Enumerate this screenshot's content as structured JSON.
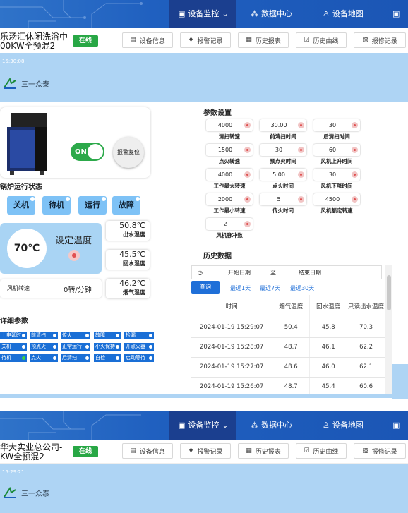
{
  "nav": {
    "items": [
      {
        "label": "设备监控",
        "icon": "monitor-icon"
      },
      {
        "label": "数据中心",
        "icon": "chart-icon"
      },
      {
        "label": "设备地图",
        "icon": "map-icon"
      },
      {
        "label": "",
        "icon": "monitor-icon"
      }
    ]
  },
  "device1": {
    "name_line1": "乐汤汇休闲洗浴中",
    "name_line2": "00KW全预混2",
    "status": "在线",
    "tabs": [
      "设备信息",
      "报警记录",
      "历史报表",
      "历史曲线",
      "报修记录"
    ],
    "timestamp": "15:30:08",
    "logo_text": "三一众泰",
    "on_label": "ON",
    "reset_label": "报警复位",
    "run_status_title": "锅炉运行状态",
    "status_buttons": [
      "关机",
      "待机",
      "运行",
      "故障"
    ],
    "set_temp_label": "设定温度",
    "set_temp_value": "70℃",
    "temps": [
      {
        "value": "50.8℃",
        "label": "出水温度"
      },
      {
        "value": "45.5℃",
        "label": "回水温度"
      },
      {
        "value": "46.2℃",
        "label": "烟气温度"
      }
    ],
    "fan_label": "风机转速",
    "fan_value": "0转/分钟",
    "detail_title": "详细参数",
    "detail_tags": [
      [
        "上电延时",
        "前清扫",
        "传火",
        "故障",
        "检漏"
      ],
      [
        "关机",
        "预点火",
        "正常运行",
        "小火保持",
        "开点火器"
      ],
      [
        "待机",
        "点火",
        "后清扫",
        "自检",
        "启动等待"
      ]
    ],
    "param_title": "参数设置",
    "params": [
      {
        "value": "4000",
        "label": "清扫转速"
      },
      {
        "value": "30.00",
        "label": "前清扫时间"
      },
      {
        "value": "30",
        "label": "后清扫时间"
      },
      {
        "value": "1500",
        "label": "点火转速"
      },
      {
        "value": "30",
        "label": "预点火时间"
      },
      {
        "value": "60",
        "label": "风机上升时间"
      },
      {
        "value": "4000",
        "label": "工作最大转速"
      },
      {
        "value": "5.00",
        "label": "点火时间"
      },
      {
        "value": "30",
        "label": "风机下降时间"
      },
      {
        "value": "2000",
        "label": "工作最小转速"
      },
      {
        "value": "5",
        "label": "传火时间"
      },
      {
        "value": "4500",
        "label": "风机额定转速"
      },
      {
        "value": "2",
        "label": "风机脉冲数"
      }
    ],
    "history_title": "历史数据",
    "start_date_placeholder": "开始日期",
    "to_label": "至",
    "end_date_placeholder": "结束日期",
    "query_label": "查询",
    "quick_ranges": [
      "最近1天",
      "最近7天",
      "最近30天"
    ],
    "columns": [
      "时间",
      "烟气温度",
      "回水温度",
      "只读出水温度"
    ],
    "rows": [
      [
        "2024-01-19 15:29:07",
        "50.4",
        "45.8",
        "70.3"
      ],
      [
        "2024-01-19 15:28:07",
        "48.7",
        "46.1",
        "62.2"
      ],
      [
        "2024-01-19 15:27:07",
        "48.6",
        "46.0",
        "62.1"
      ],
      [
        "2024-01-19 15:26:07",
        "48.7",
        "45.4",
        "60.6"
      ]
    ]
  },
  "device2": {
    "name_line1": "华大实业总公司-",
    "name_line2": "KW全预混2",
    "status": "在线",
    "tabs": [
      "设备信息",
      "报警记录",
      "历史报表",
      "历史曲线",
      "报修记录"
    ],
    "timestamp": "15:29:21",
    "logo_text": "三一众泰"
  }
}
